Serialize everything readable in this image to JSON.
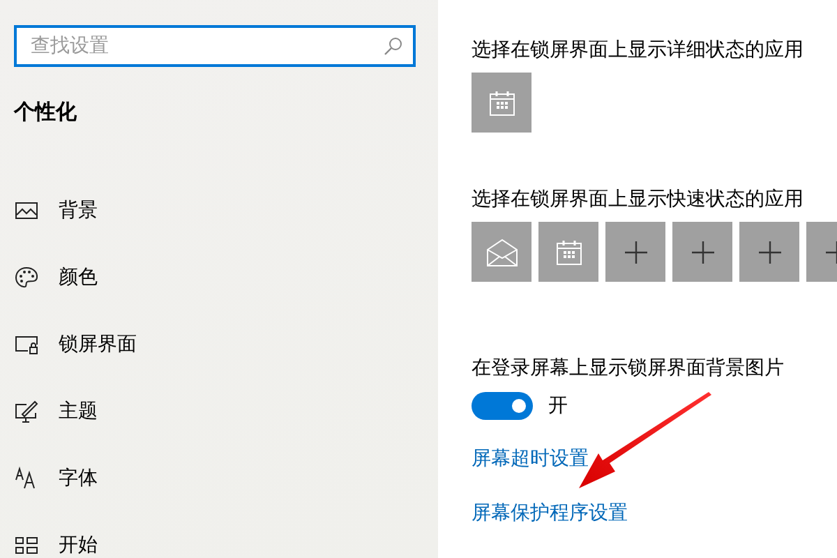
{
  "search": {
    "placeholder": "查找设置"
  },
  "section_title": "个性化",
  "nav_items": [
    {
      "label": "背景",
      "kind": "picture"
    },
    {
      "label": "颜色",
      "kind": "palette"
    },
    {
      "label": "锁屏界面",
      "kind": "lockscreen"
    },
    {
      "label": "主题",
      "kind": "theme"
    },
    {
      "label": "字体",
      "kind": "font"
    },
    {
      "label": "开始",
      "kind": "start"
    }
  ],
  "detailed_status": {
    "heading": "选择在锁屏界面上显示详细状态的应用",
    "apps": [
      {
        "kind": "calendar"
      }
    ]
  },
  "quick_status": {
    "heading": "选择在锁屏界面上显示快速状态的应用",
    "apps": [
      {
        "kind": "mail"
      },
      {
        "kind": "calendar"
      },
      {
        "kind": "add"
      },
      {
        "kind": "add"
      },
      {
        "kind": "add"
      },
      {
        "kind": "add"
      }
    ]
  },
  "login_background": {
    "heading": "在登录屏幕上显示锁屏界面背景图片",
    "toggle": {
      "on": true,
      "label": "开"
    }
  },
  "links": [
    "屏幕超时设置",
    "屏幕保护程序设置"
  ]
}
